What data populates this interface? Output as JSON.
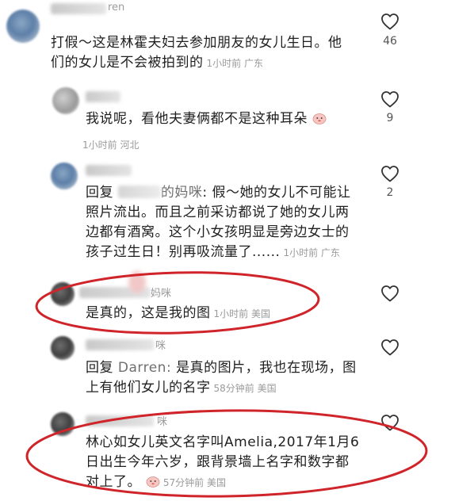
{
  "comments": [
    {
      "name_fragment": "ren",
      "text_lines": [
        "打假～这是林霍夫妇去参加朋友的女儿生日。他",
        "们的女儿是不会被拍到的"
      ],
      "time": "1小时前",
      "location": "广东",
      "likes": "46"
    },
    {
      "name_fragment": "",
      "text_lines": [
        "我说呢，看他夫妻俩都不是这种耳朵"
      ],
      "time": "1小时前",
      "location": "河北",
      "likes": "9"
    },
    {
      "name_fragment": "",
      "reply_word": "回复",
      "reply_target": "的妈咪",
      "text_lines": [
        "假～她的女儿不可能让",
        "照片流出。而且之前采访都说了她的女儿两",
        "边都有酒窝。这个小女孩明显是旁边女士的",
        "孩子过生日！别再吸流量了......"
      ],
      "time": "1小时前",
      "location": "广东",
      "likes": "2"
    },
    {
      "name_fragment": "妈咪",
      "text_lines": [
        "是真的，这是我的图"
      ],
      "time": "1小时前",
      "location": "美国",
      "likes": ""
    },
    {
      "name_fragment": "咪",
      "reply_word": "回复",
      "reply_target": "Darren:",
      "text_lines": [
        "是真的图片，我也在现场，图",
        "上有他们女儿的名字"
      ],
      "time": "58分钟前",
      "location": "美国",
      "likes": ""
    },
    {
      "name_fragment": "咪",
      "text_lines": [
        "林心如女儿英文名字叫Amelia,2017年1月6",
        "日出生今年六岁，跟背景墙上名字和数字都",
        "对上了。"
      ],
      "time": "57分钟前",
      "location": "美国",
      "likes": ""
    }
  ],
  "colors": {
    "highlight_ellipse": "#d0242b",
    "meta_text": "#9a9a9a",
    "body_text": "#1f1f1f"
  },
  "icons": {
    "like": "heart-outline-icon",
    "emoji": "blushing-face-emoji"
  }
}
